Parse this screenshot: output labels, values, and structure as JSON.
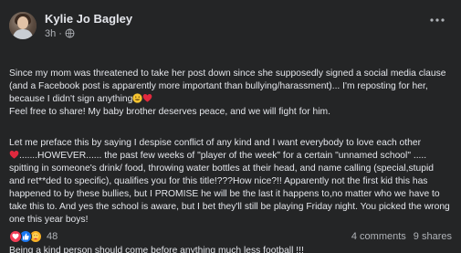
{
  "post": {
    "author": "Kylie Jo Bagley",
    "time": "3h",
    "separator": "·",
    "more_icon": "ellipsis-icon",
    "privacy_icon": "globe-icon",
    "paragraphs": [
      "Since my mom was threatened to take her post down since she supposedly signed a social media clause (and a Facebook post is apparently more important than bullying/harassment)... I'm reposting for her, because I didn't sign anything",
      "Feel free to share! My baby brother deserves peace, and we will fight for him.",
      "Let me preface this by saying I despise conflict of any kind and I want everybody to love each other",
      ".......HOWEVER...... the past few weeks of \"player of the week\" for a certain \"unnamed school\" ..... spitting in someone's drink/ food, throwing water bottles at their head, and name calling (special,stupid and ret**ded to specific), qualifies you for this title!???How nice?!!  Apparently not the first kid this has happened to by these bullies, but I PROMISE he will be the last it happens to,no matter who we have to take this to. And yes the school is aware, but I bet they'll still be playing Friday night. You picked the wrong one this year boys!",
      "Being a kind person should come before anything much less football !!!"
    ]
  },
  "reactions": {
    "count": "48",
    "types": [
      "love",
      "like",
      "care"
    ]
  },
  "stats": {
    "comments": "4 comments",
    "shares": "9 shares"
  },
  "colors": {
    "background": "#242526",
    "text": "#e4e6eb",
    "secondary": "#b0b3b8",
    "love": "#f33e58",
    "like": "#1877f2",
    "care": "#f7b125"
  }
}
